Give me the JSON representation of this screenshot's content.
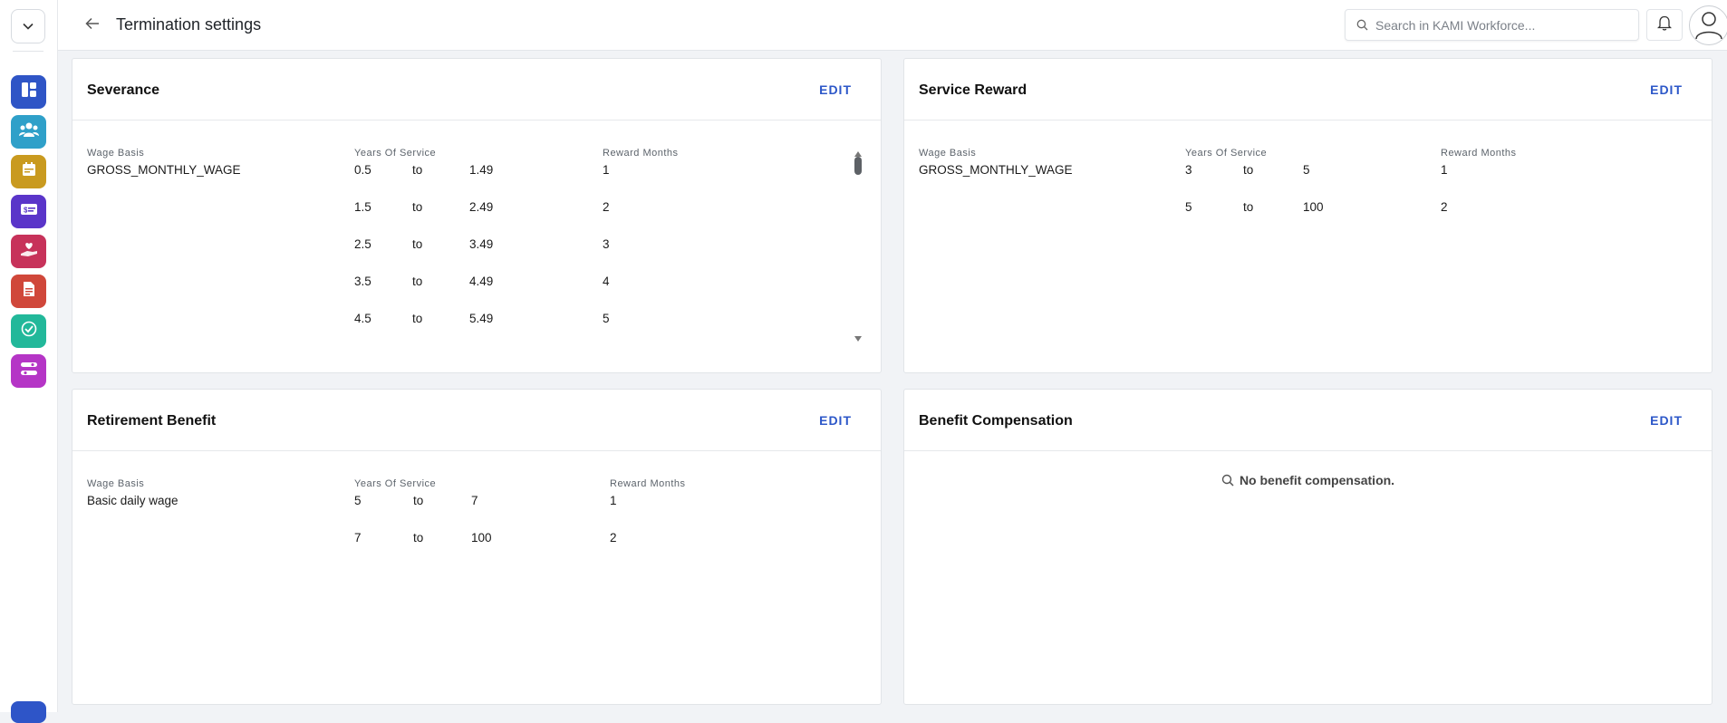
{
  "header": {
    "title": "Termination settings",
    "search_placeholder": "Search in KAMI Workforce..."
  },
  "sidebar": {
    "apps": [
      {
        "icon": "dashboard-icon",
        "color": "#2f55c6"
      },
      {
        "icon": "people-icon",
        "color": "#2fa0c9"
      },
      {
        "icon": "calendar-icon",
        "color": "#c99a1f"
      },
      {
        "icon": "payroll-card-icon",
        "color": "#5a35c9"
      },
      {
        "icon": "heart-hand-icon",
        "color": "#c7325a"
      },
      {
        "icon": "document-icon",
        "color": "#d0473a"
      },
      {
        "icon": "check-badge-icon",
        "color": "#22b89a"
      },
      {
        "icon": "toggle-settings-icon",
        "color": "#b535c6"
      }
    ]
  },
  "severance": {
    "title": "Severance",
    "edit_label": "EDIT",
    "wage_basis_label": "Wage Basis",
    "wage_basis_value": "GROSS_MONTHLY_WAGE",
    "years_label": "Years Of Service",
    "reward_label": "Reward Months",
    "rows": [
      {
        "from": "0.5",
        "to_word": "to",
        "to": "1.49",
        "months": "1"
      },
      {
        "from": "1.5",
        "to_word": "to",
        "to": "2.49",
        "months": "2"
      },
      {
        "from": "2.5",
        "to_word": "to",
        "to": "3.49",
        "months": "3"
      },
      {
        "from": "3.5",
        "to_word": "to",
        "to": "4.49",
        "months": "4"
      },
      {
        "from": "4.5",
        "to_word": "to",
        "to": "5.49",
        "months": "5"
      }
    ]
  },
  "service_reward": {
    "title": "Service Reward",
    "edit_label": "EDIT",
    "wage_basis_label": "Wage Basis",
    "wage_basis_value": "GROSS_MONTHLY_WAGE",
    "years_label": "Years Of Service",
    "reward_label": "Reward Months",
    "rows": [
      {
        "from": "3",
        "to_word": "to",
        "to": "5",
        "months": "1"
      },
      {
        "from": "5",
        "to_word": "to",
        "to": "100",
        "months": "2"
      }
    ]
  },
  "retirement_benefit": {
    "title": "Retirement Benefit",
    "edit_label": "EDIT",
    "wage_basis_label": "Wage Basis",
    "wage_basis_value": "Basic daily wage",
    "years_label": "Years Of Service",
    "reward_label": "Reward Months",
    "rows": [
      {
        "from": "5",
        "to_word": "to",
        "to": "7",
        "months": "1"
      },
      {
        "from": "7",
        "to_word": "to",
        "to": "100",
        "months": "2"
      }
    ]
  },
  "benefit_compensation": {
    "title": "Benefit Compensation",
    "edit_label": "EDIT",
    "empty_text": "No benefit compensation."
  }
}
